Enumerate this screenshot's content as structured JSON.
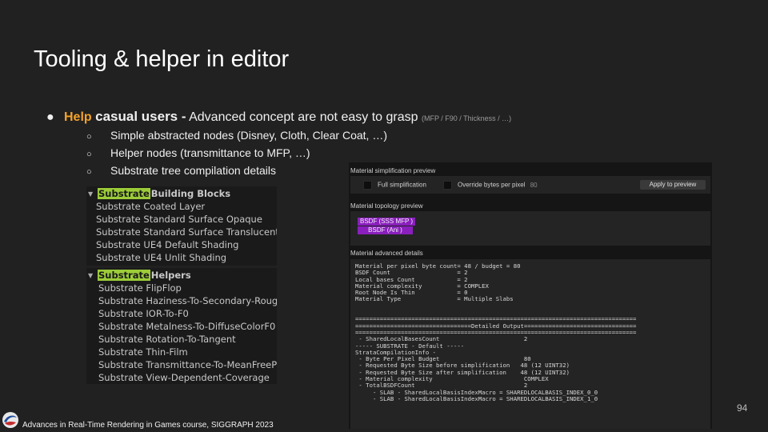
{
  "title": "Tooling & helper in editor",
  "bullet": {
    "marker": "●",
    "highlight": "Help",
    "bold": "casual users -",
    "text": "Advanced concept are not easy to grasp",
    "small": "(MFP  / F90 / Thickness / …)"
  },
  "subbullets": [
    {
      "marker": "○",
      "text": "Simple abstracted nodes (Disney, Cloth, Clear Coat, …)"
    },
    {
      "marker": "○",
      "text": "Helper nodes (transmittance  to MFP, …)"
    },
    {
      "marker": "○",
      "text": "Substrate tree compilation details"
    }
  ],
  "building_blocks": {
    "highlight": "Substrate",
    "heading_tail": "Building Blocks",
    "items": [
      "Substrate Coated Layer",
      "Substrate Standard Surface Opaque",
      "Substrate Standard Surface Translucent",
      "Substrate UE4 Default Shading",
      "Substrate UE4 Unlit Shading"
    ]
  },
  "helpers": {
    "highlight": "Substrate",
    "heading_tail": "Helpers",
    "items": [
      "Substrate FlipFlop",
      "Substrate Haziness-To-Secondary-Roughn",
      "Substrate IOR-To-F0",
      "Substrate Metalness-To-DiffuseColorF0",
      "Substrate Rotation-To-Tangent",
      "Substrate Thin-Film",
      "Substrate Transmittance-To-MeanFreePath",
      "Substrate View-Dependent-Coverage"
    ]
  },
  "editor": {
    "simplification_label": "Material simplification preview",
    "full_simplification": "Full simplification",
    "override_bytes": "Override bytes per pixel",
    "override_value": "80",
    "apply_button": "Apply to preview",
    "topology_label": "Material topology preview",
    "bsdf_nodes": [
      "BSDF (SSS MFP )",
      "BSDF (Ani )"
    ],
    "advanced_label": "Material advanced details",
    "details_text": "Material per pixel byte count= 48 / budget = 80\nBSDF Count                   = 2\nLocal bases Count            = 2\nMaterial complexity          = COMPLEX\nRoot Node Is Thin            = 0\nMaterial Type                = Multiple Slabs\n\n\n================================================================================\n=================================Detailed Output================================\n================================================================================\n - SharedLocalBasesCount                        2\n----- SUBSTRATE - Default -----\nStrataCompilationInfo -\n - Byte Per Pixel Budget                        80\n - Requested Byte Size before simplification   48 (12 UINT32)\n - Requested Byte Size after simplification    48 (12 UINT32)\n - Material complexity                          COMPLEX\n - TotalBSDFCount                               2\n     - SLAB - SharedLocalBasisIndexMacro = SHAREDLOCALBASIS_INDEX_0_0\n     - SLAB - SharedLocalBasisIndexMacro = SHAREDLOCALBASIS_INDEX_1_0"
  },
  "footer": "Advances in Real-Time Rendering in Games course, SIGGRAPH  2023",
  "page_number": "94",
  "colors": {
    "accent": "#f5a22b",
    "highlight": "#9ccc38",
    "bsdf": "#8a1fbd",
    "background": "#212121"
  }
}
